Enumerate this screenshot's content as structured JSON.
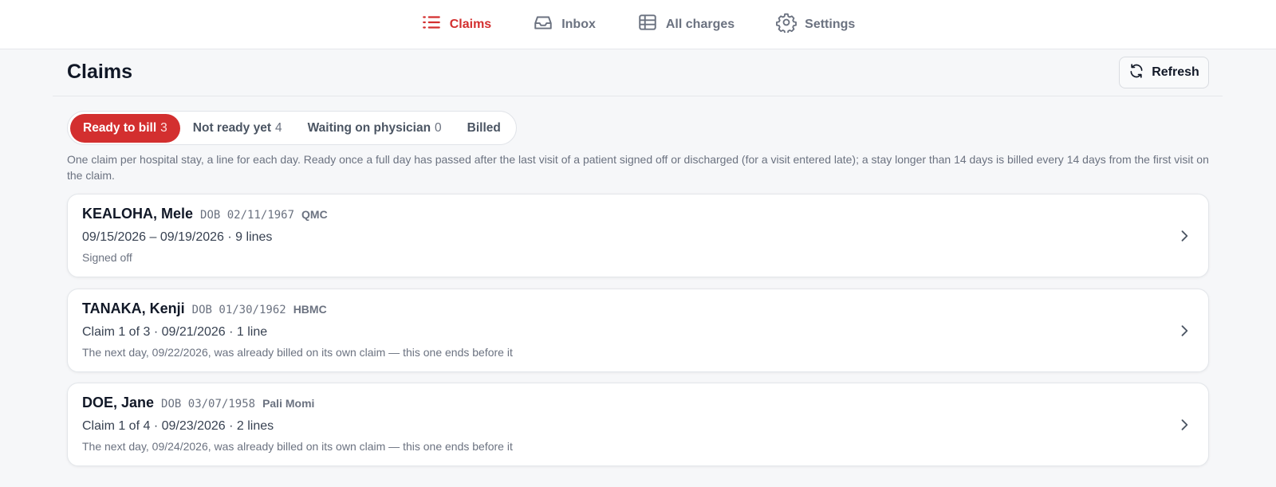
{
  "nav": {
    "items": [
      {
        "label": "Claims",
        "icon": "list-icon",
        "active": true
      },
      {
        "label": "Inbox",
        "icon": "inbox-icon",
        "active": false
      },
      {
        "label": "All charges",
        "icon": "table-icon",
        "active": false
      },
      {
        "label": "Settings",
        "icon": "gear-icon",
        "active": false
      }
    ]
  },
  "header": {
    "title": "Claims",
    "refresh_label": "Refresh"
  },
  "tabs": [
    {
      "label": "Ready to bill",
      "count": "3",
      "active": true
    },
    {
      "label": "Not ready yet",
      "count": "4",
      "active": false
    },
    {
      "label": "Waiting on physician",
      "count": "0",
      "active": false
    },
    {
      "label": "Billed",
      "count": "",
      "active": false
    }
  ],
  "description": "One claim per hospital stay, a line for each day. Ready once a full day has passed after the last visit of a patient signed off or discharged (for a visit entered late); a stay longer than 14 days is billed every 14 days from the first visit on the claim.",
  "claims": [
    {
      "name": "KEALOHA, Mele",
      "dob": "DOB 02/11/1967",
      "hospital": "QMC",
      "summary": "09/15/2026 – 09/19/2026 · 9 lines",
      "status": "Signed off"
    },
    {
      "name": "TANAKA, Kenji",
      "dob": "DOB 01/30/1962",
      "hospital": "HBMC",
      "summary": "Claim 1 of 3 · 09/21/2026 · 1 line",
      "status": "The next day, 09/22/2026, was already billed on its own claim — this one ends before it"
    },
    {
      "name": "DOE, Jane",
      "dob": "DOB 03/07/1958",
      "hospital": "Pali Momi",
      "summary": "Claim 1 of 4 · 09/23/2026 · 2 lines",
      "status": "The next day, 09/24/2026, was already billed on its own claim — this one ends before it"
    }
  ],
  "colors": {
    "accent": "#d32f2f",
    "muted": "#6b7280",
    "background": "#f6f7f9"
  }
}
